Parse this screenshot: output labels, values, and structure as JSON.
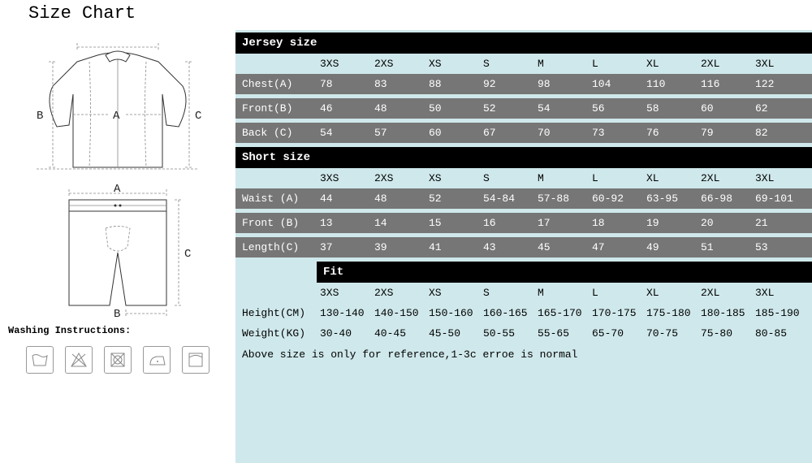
{
  "title": "Size Chart",
  "washing_label": "Washing Instructions:",
  "diagram_labels": {
    "jersey_A": "A",
    "jersey_B": "B",
    "jersey_C": "C",
    "short_A": "A",
    "short_B": "B",
    "short_C": "C"
  },
  "wash_icons": [
    "wash-basin",
    "no-bleach",
    "no-tumble",
    "iron",
    "hang-dry"
  ],
  "columns": [
    "3XS",
    "2XS",
    "XS",
    "S",
    "M",
    "L",
    "XL",
    "2XL",
    "3XL"
  ],
  "sections": [
    {
      "title": "Jersey size",
      "rows": [
        {
          "label": "Chest(A)",
          "cls": "grey",
          "vals": [
            "78",
            "83",
            "88",
            "92",
            "98",
            "104",
            "110",
            "116",
            "122"
          ]
        },
        {
          "label": "Front(B)",
          "cls": "grey",
          "vals": [
            "46",
            "48",
            "50",
            "52",
            "54",
            "56",
            "58",
            "60",
            "62"
          ]
        },
        {
          "label": "Back (C)",
          "cls": "grey",
          "vals": [
            "54",
            "57",
            "60",
            "67",
            "70",
            "73",
            "76",
            "79",
            "82"
          ]
        }
      ]
    },
    {
      "title": "Short size",
      "rows": [
        {
          "label": "Waist (A)",
          "cls": "grey",
          "vals": [
            "44",
            "48",
            "52",
            "54-84",
            "57-88",
            "60-92",
            "63-95",
            "66-98",
            "69-101"
          ]
        },
        {
          "label": "Front (B)",
          "cls": "grey",
          "vals": [
            "13",
            "14",
            "15",
            "16",
            "17",
            "18",
            "19",
            "20",
            "21"
          ]
        },
        {
          "label": "Length(C)",
          "cls": "grey",
          "vals": [
            "37",
            "39",
            "41",
            "43",
            "45",
            "47",
            "49",
            "51",
            "53"
          ]
        }
      ]
    },
    {
      "title": "Fit",
      "rows": [
        {
          "label": "Height(CM)",
          "cls": "light",
          "vals": [
            "130-140",
            "140-150",
            "150-160",
            "160-165",
            "165-170",
            "170-175",
            "175-180",
            "180-185",
            "185-190"
          ]
        },
        {
          "label": "Weight(KG)",
          "cls": "light",
          "vals": [
            "30-40",
            "40-45",
            "45-50",
            "50-55",
            "55-65",
            "65-70",
            "70-75",
            "75-80",
            "80-85"
          ]
        }
      ]
    }
  ],
  "note": "Above size is only for reference,1-3c erroe is normal"
}
